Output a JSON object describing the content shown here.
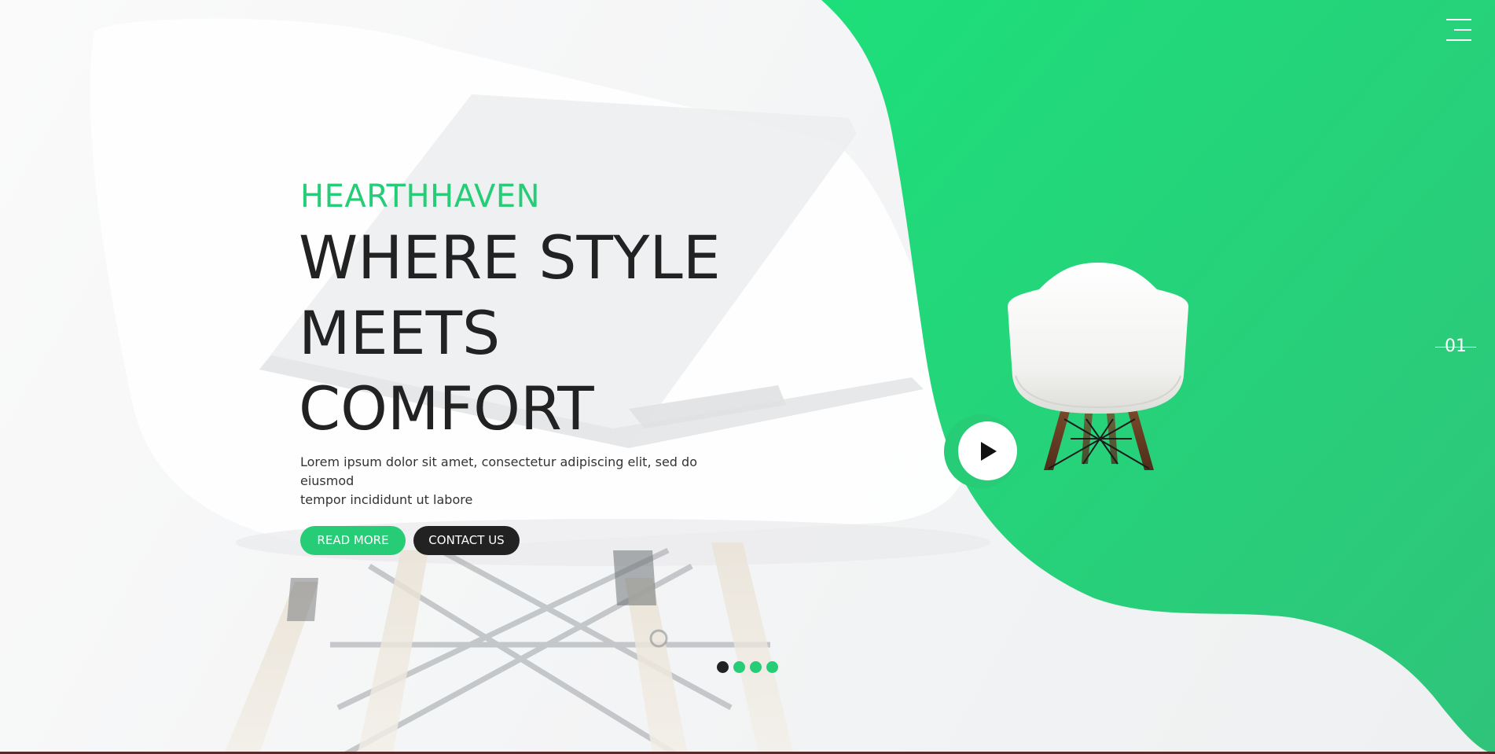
{
  "brand": "HEARTHHAVEN",
  "headline": {
    "line1": "WHERE STYLE",
    "line2": "MEETS",
    "line3": "COMFORT"
  },
  "description": {
    "line1": "Lorem ipsum dolor sit amet, consectetur adipiscing elit, sed do eiusmod",
    "line2": "tempor incididunt ut labore"
  },
  "buttons": {
    "read_more": "READ MORE",
    "contact_us": "CONTACT US"
  },
  "slide_number": "01",
  "pagination": {
    "count": 4,
    "active_index": 0
  },
  "icons": {
    "menu": "menu-icon",
    "play": "play-icon"
  },
  "colors": {
    "accent_green": "#26cc76",
    "dark": "#222222",
    "white": "#ffffff"
  }
}
